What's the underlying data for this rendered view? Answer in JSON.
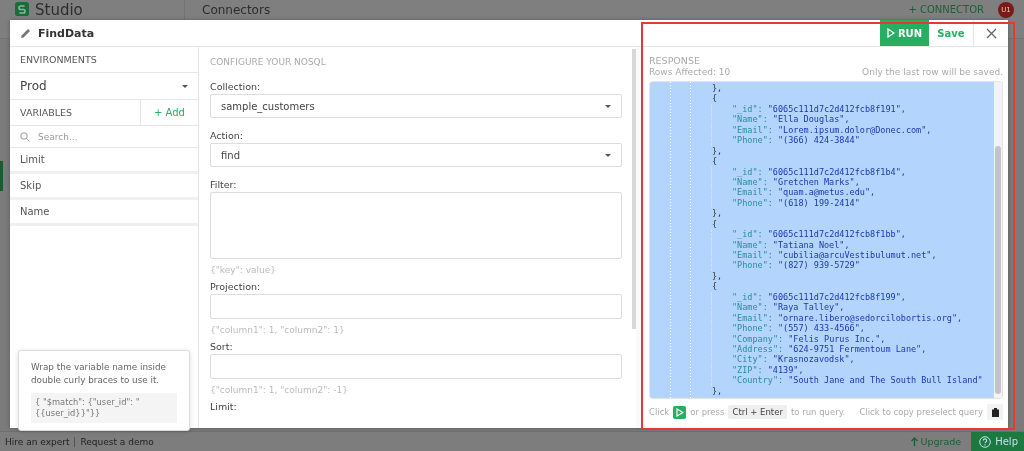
{
  "background_app": {
    "logo_text": "Studio",
    "page_title": "Connectors",
    "connector_button": "+ CONNECTOR",
    "avatar": "U1",
    "footer_links": [
      "Hire an expert",
      "Request a demo"
    ],
    "upgrade": "Upgrade",
    "help": "Help"
  },
  "dialog": {
    "title": "FindData",
    "run_button": "RUN",
    "save_button": "Save"
  },
  "environments": {
    "heading": "ENVIRONMENTS",
    "value": "Prod"
  },
  "variables": {
    "heading": "VARIABLES",
    "add_button": "+ Add",
    "search_placeholder": "Search...",
    "items": [
      "Limit",
      "Skip",
      "Name"
    ]
  },
  "hint": {
    "text": "Wrap the variable name inside double curly braces to use it.",
    "example": "{ \"$match\": {\"user_id\": \"{{user_id}}\"}}"
  },
  "configure": {
    "heading": "CONFIGURE YOUR NOSQL",
    "fields": [
      {
        "kind": "select",
        "label": "Collection:",
        "value": "sample_customers"
      },
      {
        "kind": "select",
        "label": "Action:",
        "value": "find"
      },
      {
        "kind": "textarea",
        "label": "Filter:",
        "help": "{\"key\": value}"
      },
      {
        "kind": "input",
        "label": "Projection:",
        "help": "{\"column1\": 1, \"column2\": 1}"
      },
      {
        "kind": "input",
        "label": "Sort:",
        "help": "{\"column1\": 1, \"column2\": -1}"
      },
      {
        "kind": "label",
        "label": "Limit:"
      }
    ]
  },
  "response": {
    "heading": "RESPONSE",
    "rows_affected": "Rows Affected: 10",
    "note": "Only the last row will be saved.",
    "selected": true,
    "lines": [
      {
        "kind": "brace",
        "text": "},"
      },
      {
        "kind": "brace",
        "text": "{"
      },
      {
        "kind": "pair",
        "key": "\"_id\":",
        "value": "\"6065c111d7c2d412fcb8f191\","
      },
      {
        "kind": "pair",
        "key": "\"Name\":",
        "value": "\"Ella Douglas\","
      },
      {
        "kind": "pair",
        "key": "\"Email\":",
        "value": "\"Lorem.ipsum.dolor@Donec.com\","
      },
      {
        "kind": "pair",
        "key": "\"Phone\":",
        "value": "\"(366) 424-3844\""
      },
      {
        "kind": "brace",
        "text": "},"
      },
      {
        "kind": "brace",
        "text": "{"
      },
      {
        "kind": "pair",
        "key": "\"_id\":",
        "value": "\"6065c111d7c2d412fcb8f1b4\","
      },
      {
        "kind": "pair",
        "key": "\"Name\":",
        "value": "\"Gretchen Marks\","
      },
      {
        "kind": "pair",
        "key": "\"Email\":",
        "value": "\"quam.a@metus.edu\","
      },
      {
        "kind": "pair",
        "key": "\"Phone\":",
        "value": "\"(618) 199-2414\""
      },
      {
        "kind": "brace",
        "text": "},"
      },
      {
        "kind": "brace",
        "text": "{"
      },
      {
        "kind": "pair",
        "key": "\"_id\":",
        "value": "\"6065c111d7c2d412fcb8f1bb\","
      },
      {
        "kind": "pair",
        "key": "\"Name\":",
        "value": "\"Tatiana Noel\","
      },
      {
        "kind": "pair",
        "key": "\"Email\":",
        "value": "\"cubilia@arcuVestibulumut.net\","
      },
      {
        "kind": "pair",
        "key": "\"Phone\":",
        "value": "\"(827) 939-5729\""
      },
      {
        "kind": "brace",
        "text": "},"
      },
      {
        "kind": "brace",
        "text": "{"
      },
      {
        "kind": "pair",
        "key": "\"_id\":",
        "value": "\"6065c111d7c2d412fcb8f199\","
      },
      {
        "kind": "pair",
        "key": "\"Name\":",
        "value": "\"Raya Talley\","
      },
      {
        "kind": "pair",
        "key": "\"Email\":",
        "value": "\"ornare.libero@sedorcilobortis.org\","
      },
      {
        "kind": "pair",
        "key": "\"Phone\":",
        "value": "\"(557) 433-4566\","
      },
      {
        "kind": "pair",
        "key": "\"Company\":",
        "value": "\"Felis Purus Inc.\","
      },
      {
        "kind": "pair",
        "key": "\"Address\":",
        "value": "\"624-9751 Fermentoum Lane\","
      },
      {
        "kind": "pair",
        "key": "\"City\":",
        "value": "\"Krasnozavodsk\","
      },
      {
        "kind": "pair",
        "key": "\"ZIP\":",
        "value": "\"4139\","
      },
      {
        "kind": "pair",
        "key": "\"Country\":",
        "value": "\"South Jane and The South Bull Island\""
      },
      {
        "kind": "brace",
        "text": "},"
      }
    ],
    "footer": {
      "click": "Click",
      "or_press": "or press",
      "shortcut": "Ctrl + Enter",
      "to_run": "to run query.",
      "copy_hint": "Click to copy preselect query"
    }
  }
}
